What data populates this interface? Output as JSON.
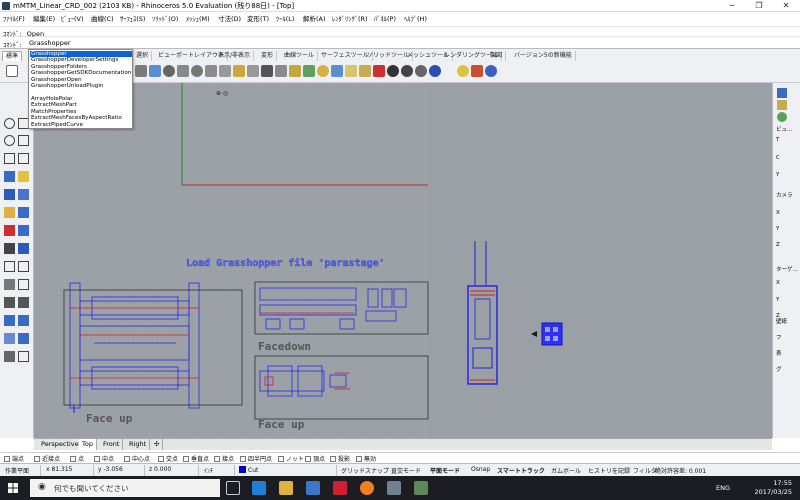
{
  "window": {
    "title": "mMTM_Linear_CRD_002 (2103 KB) - Rhinoceros 5.0 Evaluation (残り88日) - [Top]",
    "minimize": "─",
    "maximize": "❐",
    "close": "✕"
  },
  "menu": [
    "ﾌｧｲﾙ(F)",
    "編集(E)",
    "ﾋﾞｭｰ(V)",
    "曲線(C)",
    "ｻｰﾌｪｽ(S)",
    "ｿﾘｯﾄﾞ(O)",
    "ﾒｯｼｭ(M)",
    "寸法(D)",
    "変形(T)",
    "ﾂｰﾙ(L)",
    "解析(A)",
    "ﾚﾝﾀﾞﾘﾝｸﾞ(R)",
    "ﾊﾟﾈﾙ(P)",
    "ﾍﾙﾌﾟ(H)"
  ],
  "command_history": "ｺﾏﾝﾄﾞ: _Open",
  "command_line": {
    "label": "ｺﾏﾝﾄﾞ:",
    "value": "Grasshopper"
  },
  "toolbar_tabs": [
    {
      "label": "標準",
      "active": true
    },
    {
      "label": "選択"
    },
    {
      "label": "ビューポートレイアウト"
    },
    {
      "label": "表示/非表示"
    },
    {
      "label": "変形"
    },
    {
      "label": "曲線ツール"
    },
    {
      "label": "サーフェスツール"
    },
    {
      "label": "ソリッドツール"
    },
    {
      "label": "メッシュツール"
    },
    {
      "label": "レンダリングツール"
    },
    {
      "label": "製図"
    },
    {
      "label": "バージョン5の新機能"
    }
  ],
  "autocomplete": {
    "selected": "Grasshopper",
    "items": [
      "Grasshopper",
      "GrasshopperDeveloperSettings",
      "GrasshopperFolders",
      "GrasshopperGetSDKDocumentation",
      "GrasshopperOpen",
      "GrasshopperUnloadPlugin",
      "",
      "ArrayHolePolar",
      "ExtractMeshPart",
      "MatchProperties",
      "ExtractMeshFacesByAspectRatio",
      "ExtractPipedCurve"
    ]
  },
  "viewport": {
    "name": "Top",
    "annotations": {
      "load": "Load Grasshopper file 'parastage'",
      "facedown": "Facedown",
      "faceup1": "Face up",
      "faceup2": "Face up"
    },
    "colors": {
      "background": "#9aa0a6",
      "grid_minor": "#a5abb1",
      "grid_major": "#8e949a",
      "axis_x": "#b03030",
      "axis_y": "#1f8a2a",
      "geometry_blue": "#1d1de0",
      "geometry_red": "#d02020"
    }
  },
  "view_tabs": [
    "Perspective",
    "Top",
    "Front",
    "Right",
    "✣"
  ],
  "osnaps": [
    "端点",
    "近接点",
    "点",
    "中点",
    "中心点",
    "交点",
    "垂直点",
    "接点",
    "四半円点",
    "ノット",
    "頂点",
    "投影",
    "無効"
  ],
  "status": {
    "cplane": "作業平面",
    "x": "x 81.315",
    "y": "y -3.056",
    "z": "z 0.000",
    "units": "ｲﾝﾁ",
    "layer": "Cut",
    "grid_snap": "グリッドスナップ",
    "ortho": "直交モード",
    "planar": "平面モード",
    "osnap": "Osnap",
    "smarttrack": "スマートトラック",
    "gumball": "ガムボール",
    "history": "ヒストリを記録",
    "filter": "フィルタ",
    "tolerance": "絶対許容差: 0.001"
  },
  "right_panel": [
    "ビュ...",
    "T",
    "C",
    "Y",
    "カメラ",
    "X",
    "Y",
    "Z",
    "ターゲ...",
    "X",
    "Y",
    "Z",
    "壁紙",
    "フ",
    "表",
    "グ"
  ],
  "taskbar": {
    "search": "何でも聞いてください",
    "lang": "ENG",
    "time": "17:55",
    "date": "2017/03/25"
  }
}
